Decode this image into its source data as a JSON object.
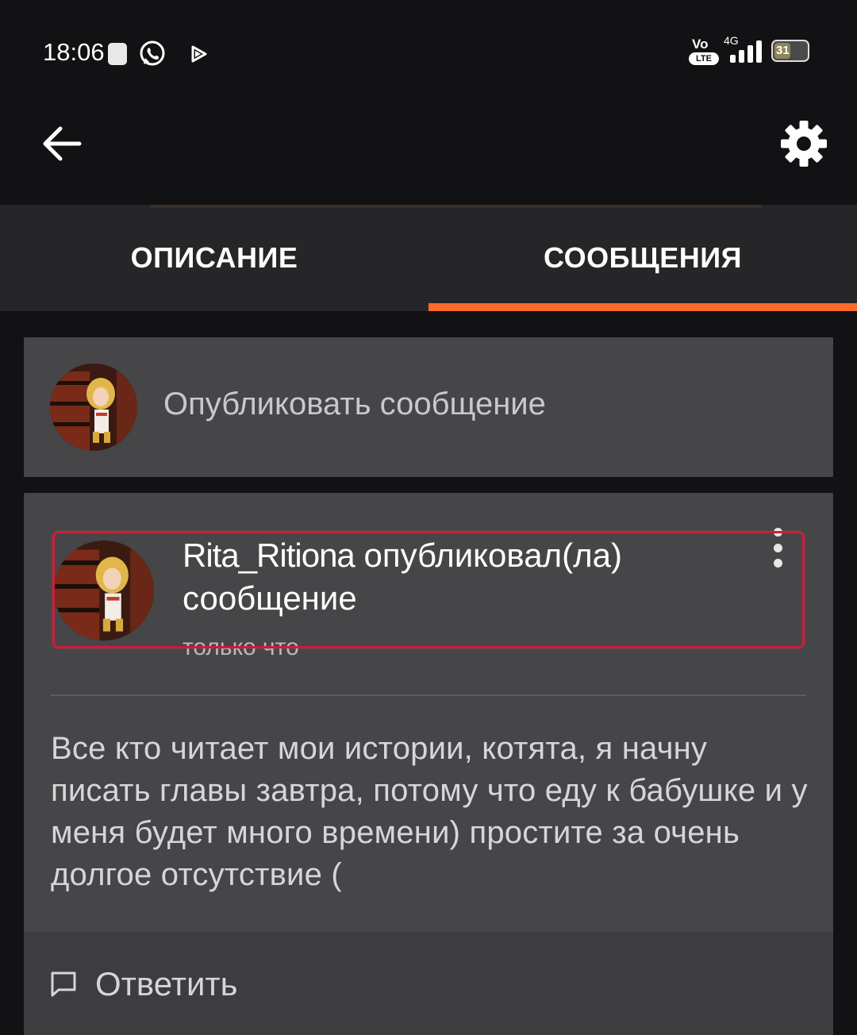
{
  "status_bar": {
    "time": "18:06",
    "network_type": "4G",
    "volte_label": "Vo",
    "lte_label": "LTE",
    "battery_level": "31",
    "icons": [
      "notification-square-icon",
      "whatsapp-icon",
      "play-store-icon",
      "volte-icon",
      "signal-icon",
      "battery-icon"
    ]
  },
  "app_bar": {
    "back_icon": "arrow-left-icon",
    "settings_icon": "gear-icon"
  },
  "tabs": [
    {
      "label": "ОПИСАНИЕ",
      "active": false
    },
    {
      "label": "СООБЩЕНИЯ",
      "active": true
    }
  ],
  "colors": {
    "accent": "#ff6a2b",
    "background": "#121113",
    "card": "#464547",
    "highlight_border": "#d11a3a"
  },
  "composer": {
    "placeholder": "Опубликовать сообщение"
  },
  "message": {
    "username": "Rita_Ritiona",
    "action": "опубликовал(ла) сообщение",
    "time_ago": "только что",
    "body": "Все кто читает мои истории, котята, я начну писать главы завтра, потому что еду к бабушке и у меня будет много времени) простите за очень долгое отсутствие (",
    "reply_label": "Ответить"
  }
}
